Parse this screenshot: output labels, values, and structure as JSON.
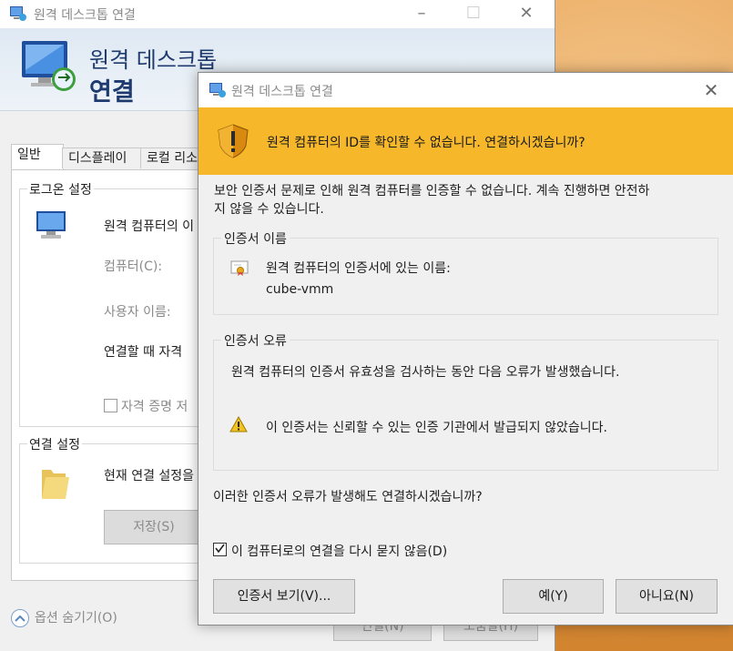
{
  "background_window": {
    "title": "원격 데스크톱 연결",
    "banner": {
      "line1": "원격 데스크톱",
      "line2": "연결"
    },
    "tabs": [
      "일반",
      "디스플레이",
      "로컬 리소"
    ],
    "logon_group": {
      "label": "로그온 설정",
      "intro": "원격 컴퓨터의 이",
      "computer_label": "컴퓨터(C):",
      "username_label": "사용자 이름:",
      "connect_text": "연결할 때 자격",
      "save_credentials": "자격 증명 저"
    },
    "connection_group": {
      "label": "연결 설정",
      "text": "현재 연결 설정을",
      "save_button": "저장(S)"
    },
    "connect_button": "연결(N)",
    "help_button": "도움말(H)",
    "hide_options": "옵션 숨기기(O)"
  },
  "dialog": {
    "title": "원격 데스크톱 연결",
    "warning_text": "원격 컴퓨터의 ID를 확인할 수 없습니다. 연결하시겠습니까?",
    "description_line1": "보안 인증서 문제로 인해 원격 컴퓨터를 인증할 수 없습니다. 계속 진행하면 안전하",
    "description_line2": "지 않을 수 있습니다.",
    "cert_name_group": {
      "label": "인증서 이름",
      "text": "원격 컴퓨터의 인증서에 있는 이름:",
      "value": "cube-vmm"
    },
    "cert_error_group": {
      "label": "인증서 오류",
      "text": "원격 컴퓨터의 인증서 유효성을 검사하는 동안 다음 오류가 발생했습니다.",
      "error_item": "이 인증서는 신뢰할 수 있는 인증 기관에서 발급되지 않았습니다."
    },
    "question": "이러한 인증서 오류가 발생해도 연결하시겠습니까?",
    "dont_ask_checkbox": {
      "label": "이 컴퓨터로의 연결을 다시 묻지 않음(D)",
      "checked": true
    },
    "buttons": {
      "view_cert": "인증서 보기(V)...",
      "yes": "예(Y)",
      "no": "아니요(N)"
    }
  },
  "colors": {
    "warning_bar": "#f6b82a",
    "banner_text": "#1e3a6e"
  }
}
